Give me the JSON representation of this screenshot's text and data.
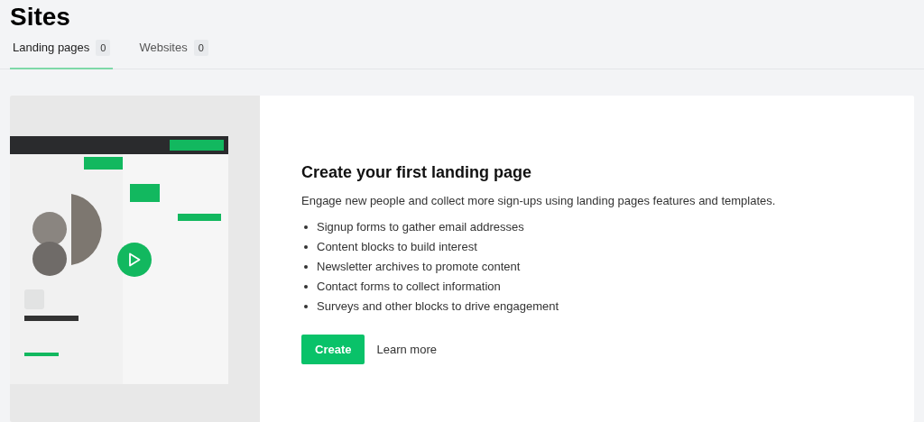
{
  "page_title": "Sites",
  "tabs": [
    {
      "label": "Landing pages",
      "count": "0",
      "selected": true
    },
    {
      "label": "Websites",
      "count": "0",
      "selected": false
    }
  ],
  "empty_state": {
    "heading": "Create your first landing page",
    "description": "Engage new people and collect more sign-ups using landing pages features and templates.",
    "features": [
      "Signup forms to gather email addresses",
      "Content blocks to build interest",
      "Newsletter archives to promote content",
      "Contact forms to collect information",
      "Surveys and other blocks to drive engagement"
    ],
    "primary_button": "Create",
    "secondary_link": "Learn more"
  }
}
